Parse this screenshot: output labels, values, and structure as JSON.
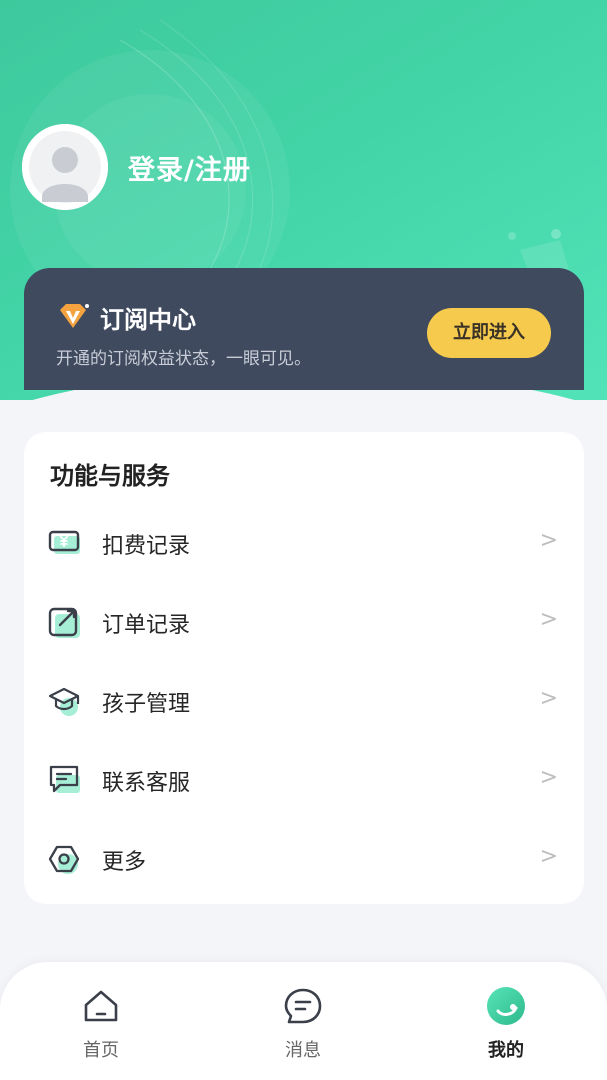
{
  "profile": {
    "login_label": "登录/注册"
  },
  "subscription": {
    "title": "订阅中心",
    "description": "开通的订阅权益状态，一眼可见。",
    "button_label": "立即进入"
  },
  "services": {
    "title": "功能与服务",
    "items": [
      {
        "label": "扣费记录",
        "icon": "yen-ticket-icon",
        "arrow": ">"
      },
      {
        "label": "订单记录",
        "icon": "edit-order-icon",
        "arrow": ">"
      },
      {
        "label": "孩子管理",
        "icon": "graduation-cap-icon",
        "arrow": ">"
      },
      {
        "label": "联系客服",
        "icon": "chat-message-icon",
        "arrow": ">"
      },
      {
        "label": "更多",
        "icon": "hexagon-settings-icon",
        "arrow": ">"
      }
    ]
  },
  "nav": {
    "items": [
      {
        "label": "首页",
        "icon": "home-icon",
        "active": false
      },
      {
        "label": "消息",
        "icon": "message-icon",
        "active": false
      },
      {
        "label": "我的",
        "icon": "profile-icon",
        "active": true
      }
    ]
  },
  "colors": {
    "accent": "#42d4a6",
    "card_dark": "#3f4a5f",
    "button_yellow": "#f6cb4d"
  }
}
